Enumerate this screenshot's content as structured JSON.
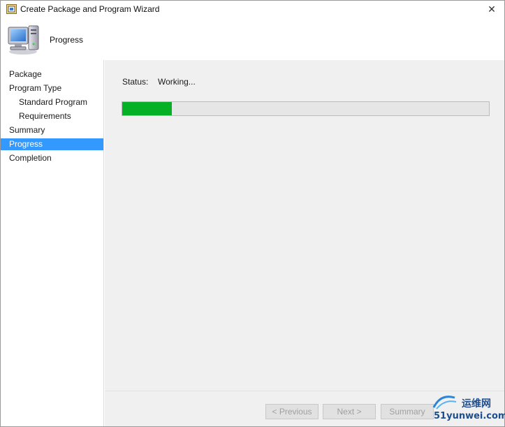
{
  "window": {
    "title": "Create Package and Program Wizard",
    "close_symbol": "✕"
  },
  "header": {
    "title": "Progress",
    "icon": "computer-icon"
  },
  "sidebar": {
    "items": [
      {
        "label": "Package",
        "sub": false,
        "active": false
      },
      {
        "label": "Program Type",
        "sub": false,
        "active": false
      },
      {
        "label": "Standard Program",
        "sub": true,
        "active": false
      },
      {
        "label": "Requirements",
        "sub": true,
        "active": false
      },
      {
        "label": "Summary",
        "sub": false,
        "active": false
      },
      {
        "label": "Progress",
        "sub": false,
        "active": true
      },
      {
        "label": "Completion",
        "sub": false,
        "active": false
      }
    ]
  },
  "main": {
    "status_label": "Status:",
    "status_value": "Working...",
    "progress_percent": 13.5,
    "progress_color": "#06b025"
  },
  "footer": {
    "previous_label": "< Previous",
    "next_label": "Next >",
    "summary_label": "Summary"
  },
  "watermark": {
    "line1": "运维网",
    "line2": "51yunwei.com"
  },
  "colors": {
    "accent": "#3399ff",
    "content_bg": "#f0f0f0"
  }
}
